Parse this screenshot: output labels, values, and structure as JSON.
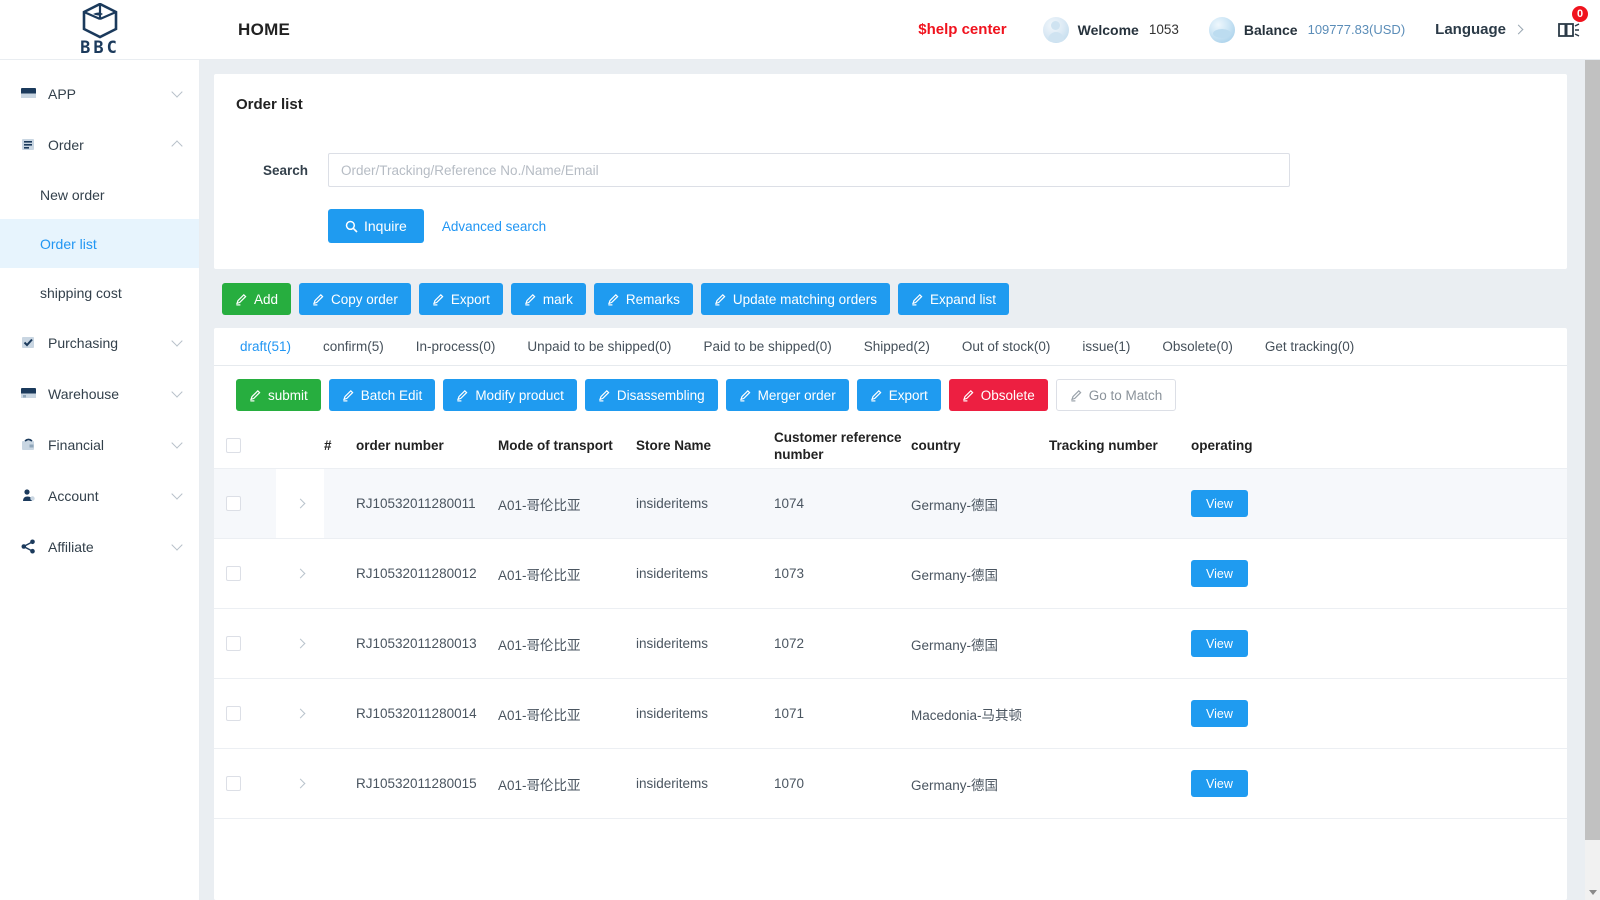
{
  "header": {
    "logo_text": "BBC",
    "home_label": "HOME",
    "help_center": "$help center",
    "welcome_label": "Welcome",
    "welcome_value": "1053",
    "balance_label": "Balance",
    "balance_value": "109777.83(USD)",
    "language_label": "Language",
    "notification_count": "0"
  },
  "sidebar": {
    "items": [
      {
        "label": "APP",
        "icon": "app-icon",
        "expanded": false
      },
      {
        "label": "Order",
        "icon": "order-icon",
        "expanded": true
      },
      {
        "label": "Purchasing",
        "icon": "purchasing-icon",
        "expanded": false
      },
      {
        "label": "Warehouse",
        "icon": "warehouse-icon",
        "expanded": false
      },
      {
        "label": "Financial",
        "icon": "financial-icon",
        "expanded": false
      },
      {
        "label": "Account",
        "icon": "account-icon",
        "expanded": false
      },
      {
        "label": "Affiliate",
        "icon": "affiliate-icon",
        "expanded": false
      }
    ],
    "order_subitems": [
      {
        "label": "New order",
        "active": false
      },
      {
        "label": "Order list",
        "active": true
      },
      {
        "label": "shipping cost",
        "active": false
      }
    ]
  },
  "panel": {
    "title": "Order list",
    "search_label": "Search",
    "search_value": "",
    "search_placeholder": "Order/Tracking/Reference No./Name/Email",
    "inquire_label": "Inquire",
    "advanced_search_label": "Advanced search"
  },
  "toolbar": [
    {
      "label": "Add",
      "style": "green"
    },
    {
      "label": "Copy order",
      "style": "blue"
    },
    {
      "label": "Export",
      "style": "blue"
    },
    {
      "label": "mark",
      "style": "blue"
    },
    {
      "label": "Remarks",
      "style": "blue"
    },
    {
      "label": "Update matching orders",
      "style": "blue"
    },
    {
      "label": "Expand list",
      "style": "blue"
    }
  ],
  "tabs": [
    {
      "label": "draft(51)",
      "active": true
    },
    {
      "label": "confirm(5)",
      "active": false
    },
    {
      "label": "In-process(0)",
      "active": false
    },
    {
      "label": "Unpaid to be shipped(0)",
      "active": false
    },
    {
      "label": "Paid to be shipped(0)",
      "active": false
    },
    {
      "label": "Shipped(2)",
      "active": false
    },
    {
      "label": "Out of stock(0)",
      "active": false
    },
    {
      "label": "issue(1)",
      "active": false
    },
    {
      "label": "Obsolete(0)",
      "active": false
    },
    {
      "label": "Get tracking(0)",
      "active": false
    }
  ],
  "toolbar2": [
    {
      "label": "submit",
      "style": "green"
    },
    {
      "label": "Batch Edit",
      "style": "blue"
    },
    {
      "label": "Modify product",
      "style": "blue"
    },
    {
      "label": "Disassembling",
      "style": "blue"
    },
    {
      "label": "Merger order",
      "style": "blue"
    },
    {
      "label": "Export",
      "style": "blue"
    },
    {
      "label": "Obsolete",
      "style": "red"
    },
    {
      "label": "Go to Match",
      "style": "ghost"
    }
  ],
  "table": {
    "columns": {
      "number": "#",
      "order_number": "order number",
      "mode_of_transport": "Mode of transport",
      "store_name": "Store Name",
      "customer_reference_number": "Customer reference number",
      "country": "country",
      "tracking_number": "Tracking number",
      "operating": "operating"
    },
    "view_label": "View",
    "rows": [
      {
        "order_number": "RJ10532011280011",
        "mode_of_transport": "A01-哥伦比亚",
        "store_name": "insideritems",
        "customer_reference_number": "1074",
        "country": "Germany-德国",
        "tracking_number": ""
      },
      {
        "order_number": "RJ10532011280012",
        "mode_of_transport": "A01-哥伦比亚",
        "store_name": "insideritems",
        "customer_reference_number": "1073",
        "country": "Germany-德国",
        "tracking_number": ""
      },
      {
        "order_number": "RJ10532011280013",
        "mode_of_transport": "A01-哥伦比亚",
        "store_name": "insideritems",
        "customer_reference_number": "1072",
        "country": "Germany-德国",
        "tracking_number": ""
      },
      {
        "order_number": "RJ10532011280014",
        "mode_of_transport": "A01-哥伦比亚",
        "store_name": "insideritems",
        "customer_reference_number": "1071",
        "country": "Macedonia-马其顿",
        "tracking_number": ""
      },
      {
        "order_number": "RJ10532011280015",
        "mode_of_transport": "A01-哥伦比亚",
        "store_name": "insideritems",
        "customer_reference_number": "1070",
        "country": "Germany-德国",
        "tracking_number": ""
      }
    ]
  },
  "colors": {
    "primary": "#1f9bf0",
    "green": "#27ae3f",
    "red": "#ed1f41",
    "link": "#2196f3",
    "help": "#f0131e"
  }
}
